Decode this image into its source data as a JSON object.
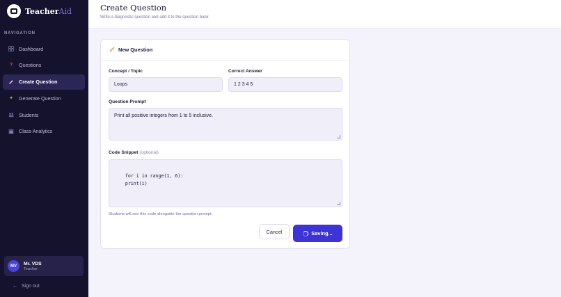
{
  "app": {
    "brand_main": "Teacher",
    "brand_accent": "Aid"
  },
  "sidebar": {
    "heading": "NAVIGATION",
    "items": [
      {
        "label": "Dashboard",
        "icon": "grid-icon"
      },
      {
        "label": "Questions",
        "icon": "question-icon"
      },
      {
        "label": "Create Question",
        "icon": "pencil-icon",
        "active": true
      },
      {
        "label": "Generate Question",
        "icon": "sparkles-icon"
      },
      {
        "label": "Students",
        "icon": "users-icon"
      },
      {
        "label": "Class Analytics",
        "icon": "chart-icon"
      }
    ],
    "user": {
      "initials": "MV",
      "name": "Mr. VDS",
      "role": "Teacher"
    },
    "signout": "Sign out"
  },
  "header": {
    "title": "Create Question",
    "subtitle": "Write a diagnostic question and add it to the question bank"
  },
  "form": {
    "title": "New Question",
    "concept_label": "Concept / Topic",
    "concept_value": "Loops",
    "answer_label": "Correct Answer",
    "answer_value": "1 2 3 4 5",
    "prompt_label": "Question Prompt",
    "prompt_value": "Print all positive integers from 1 to 5 inclusive.",
    "snippet_label": "Code Snippet",
    "snippet_optional": "(optional)",
    "snippet_value": "for i in range(1, 6):\n    print(i)",
    "hint": "Students will see this code alongside the question prompt.",
    "cancel_label": "Cancel",
    "save_label": "Saving..."
  },
  "colors": {
    "sidebar_bg": "#15122e",
    "accent": "#3e34d6",
    "active_item": "#2a2655"
  }
}
